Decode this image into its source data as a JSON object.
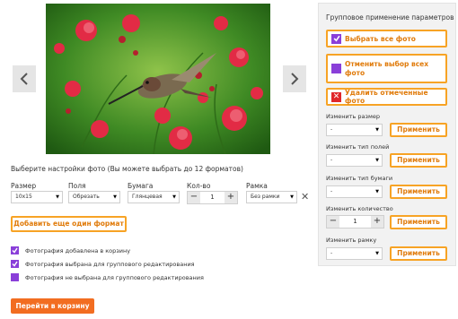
{
  "gallery": {
    "prev_icon": "chevron-left-icon",
    "next_icon": "chevron-right-icon",
    "image_alt": "hummingbird-on-red-flowers"
  },
  "settings": {
    "heading": "Выберите настройки фото (Вы можете выбрать до 12 форматов)",
    "labels": {
      "size": "Размер",
      "fields": "Поля",
      "paper": "Бумага",
      "qty": "Кол-во",
      "frame": "Рамка"
    },
    "values": {
      "size": "10x15",
      "fields": "Обрезать",
      "paper": "Глянцевая",
      "qty": "1",
      "frame": "Без рамки"
    },
    "add_format": "Добавить еще один формат"
  },
  "legend": [
    {
      "icon": "checked-box-icon",
      "text": "Фотография добавлена в корзину",
      "color": "#8a3fd9"
    },
    {
      "icon": "check-icon",
      "text": "Фотография выбрана для группового редактирования",
      "color": "#8a3fd9"
    },
    {
      "icon": "square-icon",
      "text": "Фотография не выбрана для группового редактирования",
      "color": "#8a3fd9"
    }
  ],
  "cart_button": "Перейти в корзину",
  "panel": {
    "title": "Групповое применение параметров",
    "select_all": "Выбрать все фото",
    "deselect_all": "Отменить выбор всех фото",
    "delete_selected": "Удалить отмеченные фото",
    "apply": "Применить",
    "change_size": "Изменить размер",
    "change_fields": "Изменить тип полей",
    "change_paper": "Изменить тип бумаги",
    "change_qty": "Изменить количество",
    "change_frame": "Изменить рамку",
    "dash": "-",
    "qty_value": "1"
  },
  "colors": {
    "accent": "#f7a325",
    "cart": "#f26d21",
    "purple": "#8a3fd9",
    "delete": "#e0262b"
  }
}
